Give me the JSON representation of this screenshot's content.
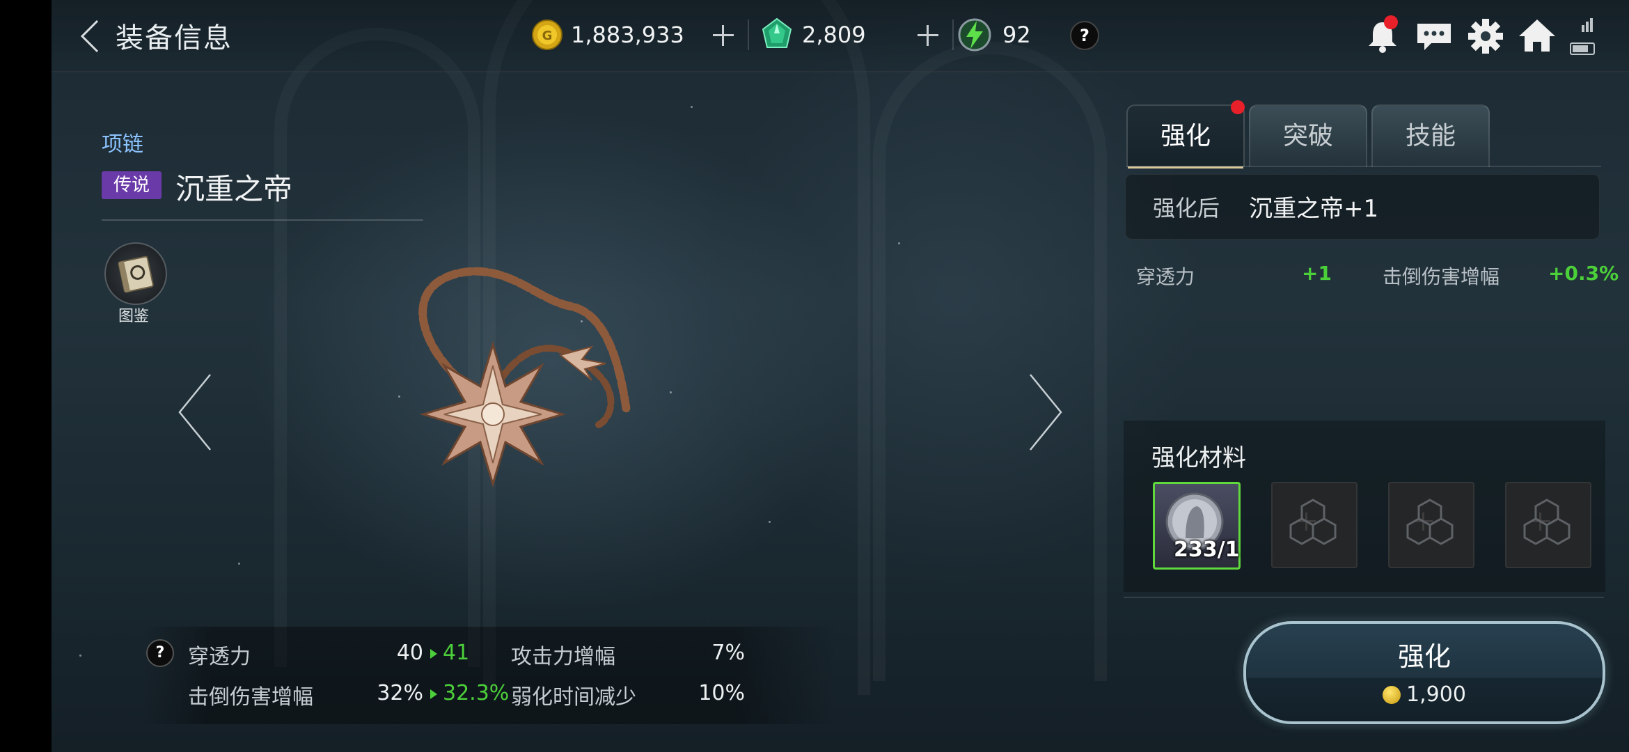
{
  "header": {
    "title": "装备信息",
    "gold": "1,883,933",
    "gems": "2,809",
    "stamina": "92",
    "help": "?"
  },
  "item": {
    "type": "项链",
    "grade": "传说",
    "name": "沉重之帝",
    "codex_label": "图鉴"
  },
  "stats": {
    "help": "?",
    "rows": [
      {
        "label": "穿透力",
        "current": "40",
        "next": "41"
      },
      {
        "label": "击倒伤害增幅",
        "current": "32%",
        "next": "32.3%"
      }
    ],
    "side": [
      {
        "label": "攻击力增幅",
        "value": "7%"
      },
      {
        "label": "弱化时间减少",
        "value": "10%"
      }
    ]
  },
  "tabs": [
    {
      "label": "强化",
      "active": true,
      "badge": true
    },
    {
      "label": "突破",
      "active": false
    },
    {
      "label": "技能",
      "active": false
    }
  ],
  "enhance": {
    "after_label": "强化后",
    "after_name": "沉重之帝+1",
    "upgrades": [
      {
        "label": "穿透力",
        "value": "+1"
      },
      {
        "label": "击倒伤害增幅",
        "value": "+0.3%"
      }
    ],
    "materials_title": "强化材料",
    "material_count": "233/1",
    "button_label": "强化",
    "cost": "1,900"
  },
  "colors": {
    "accent_green": "#4cd03a",
    "legend_purple": "#6a3aa8",
    "notify_red": "#e8202a"
  }
}
